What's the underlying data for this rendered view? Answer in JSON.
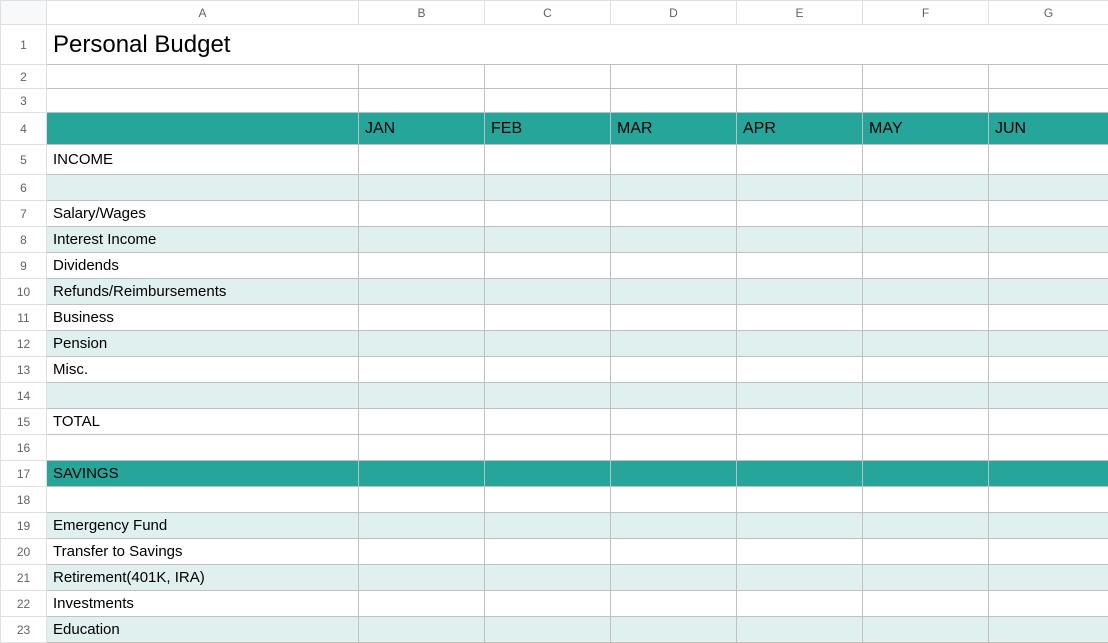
{
  "columns": [
    "A",
    "B",
    "C",
    "D",
    "E",
    "F",
    "G"
  ],
  "row_numbers": [
    1,
    2,
    3,
    4,
    5,
    6,
    7,
    8,
    9,
    10,
    11,
    12,
    13,
    14,
    15,
    16,
    17,
    18,
    19,
    20,
    21,
    22,
    23
  ],
  "title": "Personal Budget",
  "months": [
    "JAN",
    "FEB",
    "MAR",
    "APR",
    "MAY",
    "JUN"
  ],
  "rows": {
    "income_header": "INCOME",
    "salary": "Salary/Wages",
    "interest": "Interest Income",
    "dividends": "Dividends",
    "refunds": "Refunds/Reimbursements",
    "business": "Business",
    "pension": "Pension",
    "misc": "Misc.",
    "total": "TOTAL",
    "savings_header": "SAVINGS",
    "emergency": "Emergency Fund",
    "transfer": "Transfer to Savings",
    "retirement": "Retirement(401K, IRA)",
    "investments": "Investments",
    "education": "Education"
  }
}
